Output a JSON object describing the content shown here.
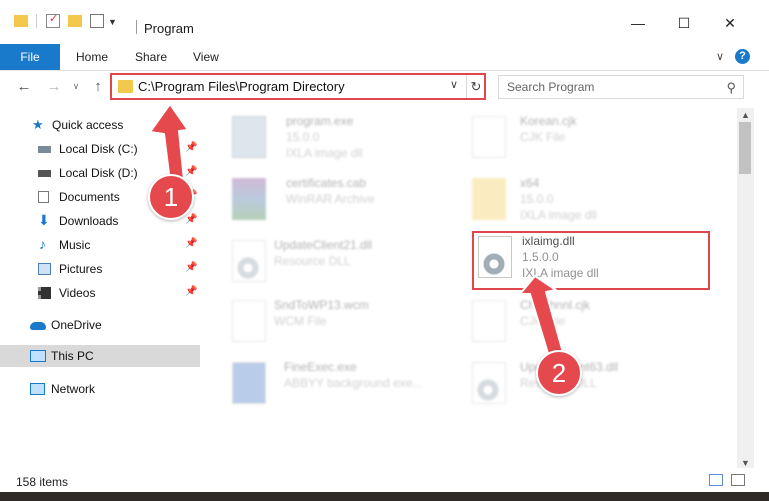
{
  "window": {
    "title": "Program",
    "minimize": "—",
    "maximize": "☐",
    "close": "✕",
    "ribbon_toggle": "∨",
    "help": "?"
  },
  "ribbon": {
    "file": "File",
    "home": "Home",
    "share": "Share",
    "view": "View"
  },
  "address": {
    "path": "C:\\Program Files\\Program Directory"
  },
  "search": {
    "placeholder": "Search Program"
  },
  "nav": {
    "quick_access": "Quick access",
    "local_c": "Local Disk (C:)",
    "local_d": "Local Disk (D:)",
    "documents": "Documents",
    "downloads": "Downloads",
    "music": "Music",
    "pictures": "Pictures",
    "videos": "Videos",
    "onedrive": "OneDrive",
    "this_pc": "This PC",
    "network": "Network"
  },
  "files": [
    {
      "name": "program.exe",
      "line1": "15.0.0",
      "line2": "IXLA image dll"
    },
    {
      "name": "Korean.cjk",
      "line1": "CJK File",
      "line2": ""
    },
    {
      "name": "certificates.cab",
      "line1": "WinRAR Archive",
      "line2": ""
    },
    {
      "name": "x64",
      "line1": "15.0.0",
      "line2": "IXLA image dll"
    },
    {
      "name": "UpdateClient21.dll",
      "line1": "Resource DLL",
      "line2": ""
    },
    {
      "name": "ixlaimg.dll",
      "line1": "1.5.0.0",
      "line2": "IXLA image dll"
    },
    {
      "name": "SndToWP13.wcm",
      "line1": "WCM File",
      "line2": ""
    },
    {
      "name": "ChsEhnnl.cjk",
      "line1": "CJK File",
      "line2": ""
    },
    {
      "name": "FineExec.exe",
      "line1": "ABBYY background exe...",
      "line2": ""
    },
    {
      "name": "UpdateClient63.dll",
      "line1": "Resource DLL",
      "line2": ""
    }
  ],
  "status": {
    "item_count": "158 items"
  },
  "annotations": {
    "badge1": "1",
    "badge2": "2",
    "color": "#e5484d"
  }
}
